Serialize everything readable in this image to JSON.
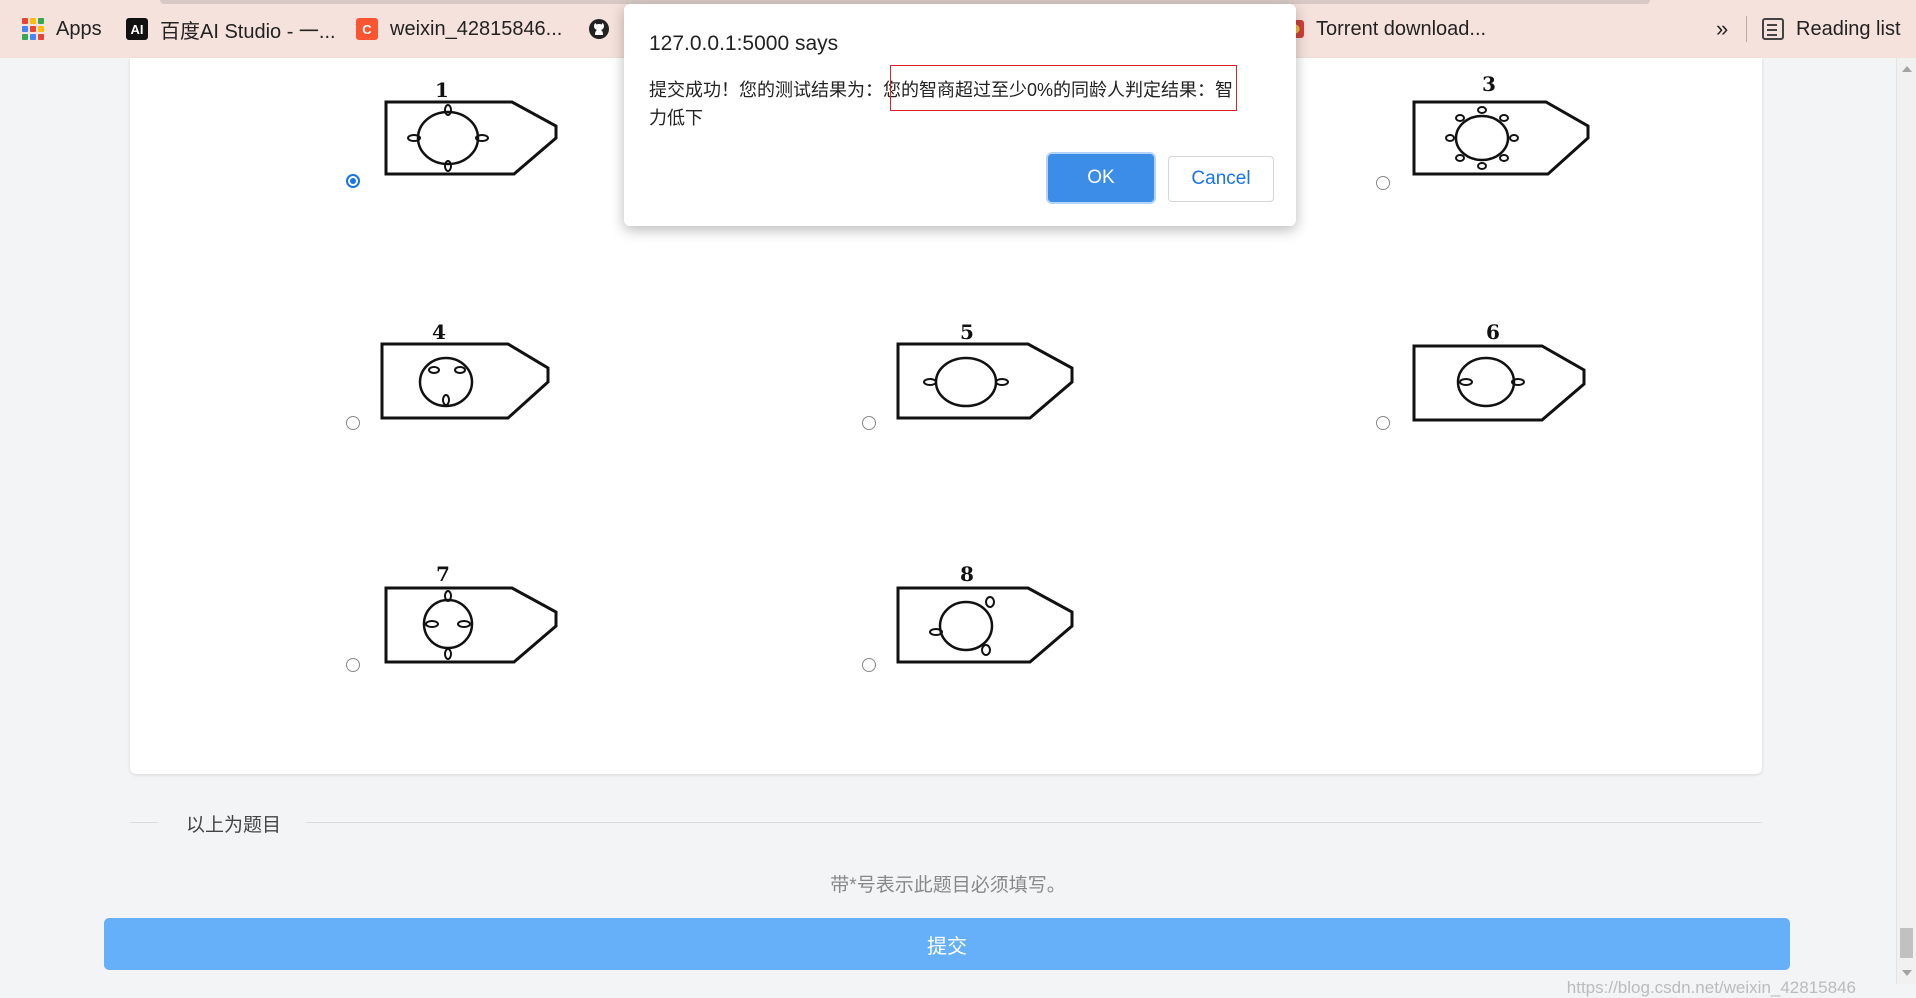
{
  "bookmarks": {
    "apps": "Apps",
    "baidu": "百度AI Studio - 一...",
    "csdn": "weixin_42815846...",
    "torrent": "Torrent download...",
    "more": "»",
    "reading_list": "Reading list"
  },
  "options": [
    {
      "number": "1",
      "checked": true
    },
    {
      "number": "3",
      "checked": false
    },
    {
      "number": "4",
      "checked": false
    },
    {
      "number": "5",
      "checked": false
    },
    {
      "number": "6",
      "checked": false
    },
    {
      "number": "7",
      "checked": false
    },
    {
      "number": "8",
      "checked": false
    }
  ],
  "divider_text": "以上为题目",
  "hint": "带*号表示此题目必须填写。",
  "submit_label": "提交",
  "watermark": "https://blog.csdn.net/weixin_42815846",
  "dialog": {
    "title": "127.0.0.1:5000 says",
    "message": "提交成功！您的测试结果为：您的智商超过至少0%的同龄人判定结果：智力低下",
    "ok": "OK",
    "cancel": "Cancel"
  },
  "colors": {
    "accent": "#1a73e8",
    "ok_button": "#3c8de8",
    "submit_button": "#66aff9",
    "highlight_box": "#e02020"
  }
}
